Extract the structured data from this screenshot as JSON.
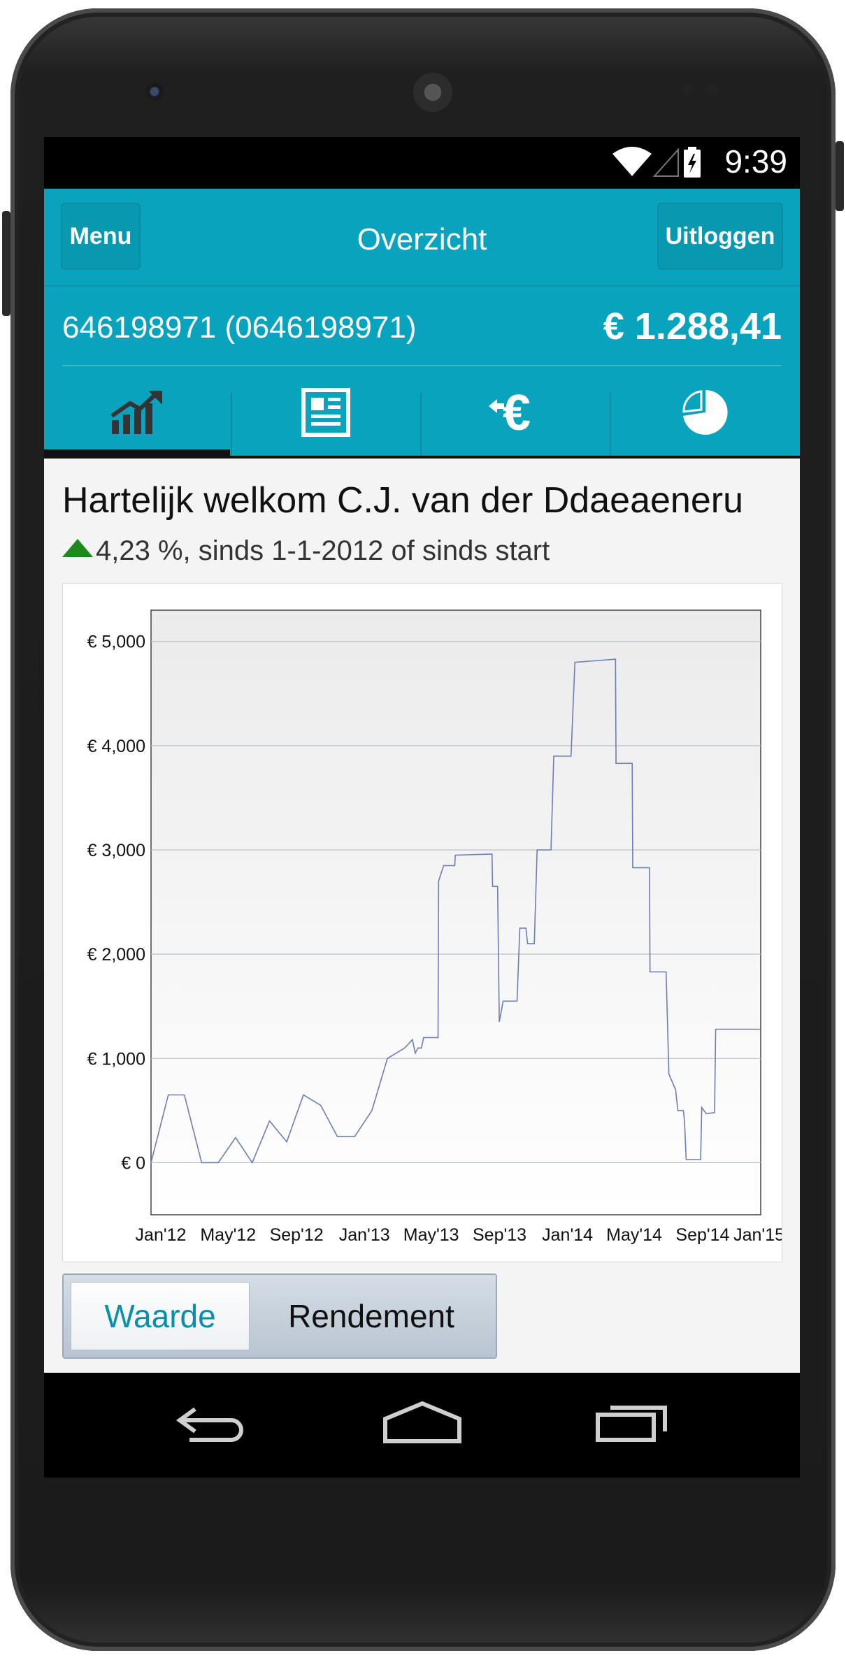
{
  "status_bar": {
    "time": "9:39",
    "icons": [
      "wifi-icon",
      "signal-icon",
      "battery-charging-icon"
    ]
  },
  "header": {
    "menu_label": "Menu",
    "title": "Overzicht",
    "logout_label": "Uitloggen"
  },
  "account": {
    "number": "646198971 (0646198971)",
    "balance": "€ 1.288,41"
  },
  "tabs": [
    {
      "icon": "chart-icon",
      "selected": true
    },
    {
      "icon": "news-icon",
      "selected": false
    },
    {
      "icon": "euro-transfer-icon",
      "selected": false
    },
    {
      "icon": "pie-chart-icon",
      "selected": false
    }
  ],
  "welcome": "Hartelijk welkom C.J. van der Ddaeaeneru",
  "performance": {
    "direction": "up",
    "text": "4,23 %, sinds 1-1-2012 of sinds start"
  },
  "toggle": {
    "value_label": "Waarde",
    "return_label": "Rendement",
    "selected": "Waarde"
  },
  "colors": {
    "accent": "#0aa3bd",
    "line": "#6b7fb3",
    "up": "#1e8a1e"
  },
  "chart_data": {
    "type": "line",
    "title": "",
    "xlabel": "",
    "ylabel": "",
    "x_ticks": [
      "Jan'12",
      "May'12",
      "Sep'12",
      "Jan'13",
      "May'13",
      "Sep'13",
      "Jan'14",
      "May'14",
      "Sep'14",
      "Jan'15"
    ],
    "y_ticks": [
      "€ 0",
      "€ 1,000",
      "€ 2,000",
      "€ 3,000",
      "€ 4,000",
      "€ 5,000"
    ],
    "xlim": [
      "2012-01-01",
      "2015-01-01"
    ],
    "ylim": [
      -500,
      5300
    ],
    "grid": true,
    "series": [
      {
        "points": [
          [
            "2012-01-01",
            0
          ],
          [
            "2012-02-01",
            650
          ],
          [
            "2012-03-01",
            650
          ],
          [
            "2012-04-01",
            0
          ],
          [
            "2012-05-01",
            0
          ],
          [
            "2012-06-01",
            240
          ],
          [
            "2012-07-01",
            0
          ],
          [
            "2012-08-01",
            400
          ],
          [
            "2012-09-01",
            200
          ],
          [
            "2012-10-01",
            650
          ],
          [
            "2012-11-01",
            550
          ],
          [
            "2012-12-01",
            250
          ],
          [
            "2013-01-01",
            250
          ],
          [
            "2013-02-01",
            500
          ],
          [
            "2013-03-01",
            1000
          ],
          [
            "2013-04-01",
            1100
          ],
          [
            "2013-04-15",
            1180
          ],
          [
            "2013-04-20",
            1050
          ],
          [
            "2013-04-25",
            1100
          ],
          [
            "2013-05-01",
            1100
          ],
          [
            "2013-05-05",
            1200
          ],
          [
            "2013-05-31",
            1200
          ],
          [
            "2013-06-01",
            2700
          ],
          [
            "2013-06-10",
            2850
          ],
          [
            "2013-06-30",
            2850
          ],
          [
            "2013-07-01",
            2950
          ],
          [
            "2013-09-05",
            2960
          ],
          [
            "2013-09-06",
            2650
          ],
          [
            "2013-09-15",
            2650
          ],
          [
            "2013-09-18",
            1350
          ],
          [
            "2013-09-25",
            1550
          ],
          [
            "2013-10-20",
            1550
          ],
          [
            "2013-10-25",
            2250
          ],
          [
            "2013-11-05",
            2250
          ],
          [
            "2013-11-08",
            2100
          ],
          [
            "2013-11-20",
            2100
          ],
          [
            "2013-11-25",
            3000
          ],
          [
            "2013-12-20",
            3000
          ],
          [
            "2013-12-25",
            3900
          ],
          [
            "2014-01-25",
            3900
          ],
          [
            "2014-02-01",
            4800
          ],
          [
            "2014-04-15",
            4830
          ],
          [
            "2014-04-16",
            3830
          ],
          [
            "2014-05-15",
            3830
          ],
          [
            "2014-05-16",
            2830
          ],
          [
            "2014-06-15",
            2830
          ],
          [
            "2014-06-16",
            1830
          ],
          [
            "2014-07-15",
            1830
          ],
          [
            "2014-07-20",
            850
          ],
          [
            "2014-08-01",
            700
          ],
          [
            "2014-08-05",
            500
          ],
          [
            "2014-08-15",
            500
          ],
          [
            "2014-08-17",
            400
          ],
          [
            "2014-08-20",
            30
          ],
          [
            "2014-09-15",
            30
          ],
          [
            "2014-09-17",
            530
          ],
          [
            "2014-09-25",
            470
          ],
          [
            "2014-10-10",
            480
          ],
          [
            "2014-10-12",
            1280
          ],
          [
            "2015-01-01",
            1280
          ]
        ]
      }
    ]
  }
}
